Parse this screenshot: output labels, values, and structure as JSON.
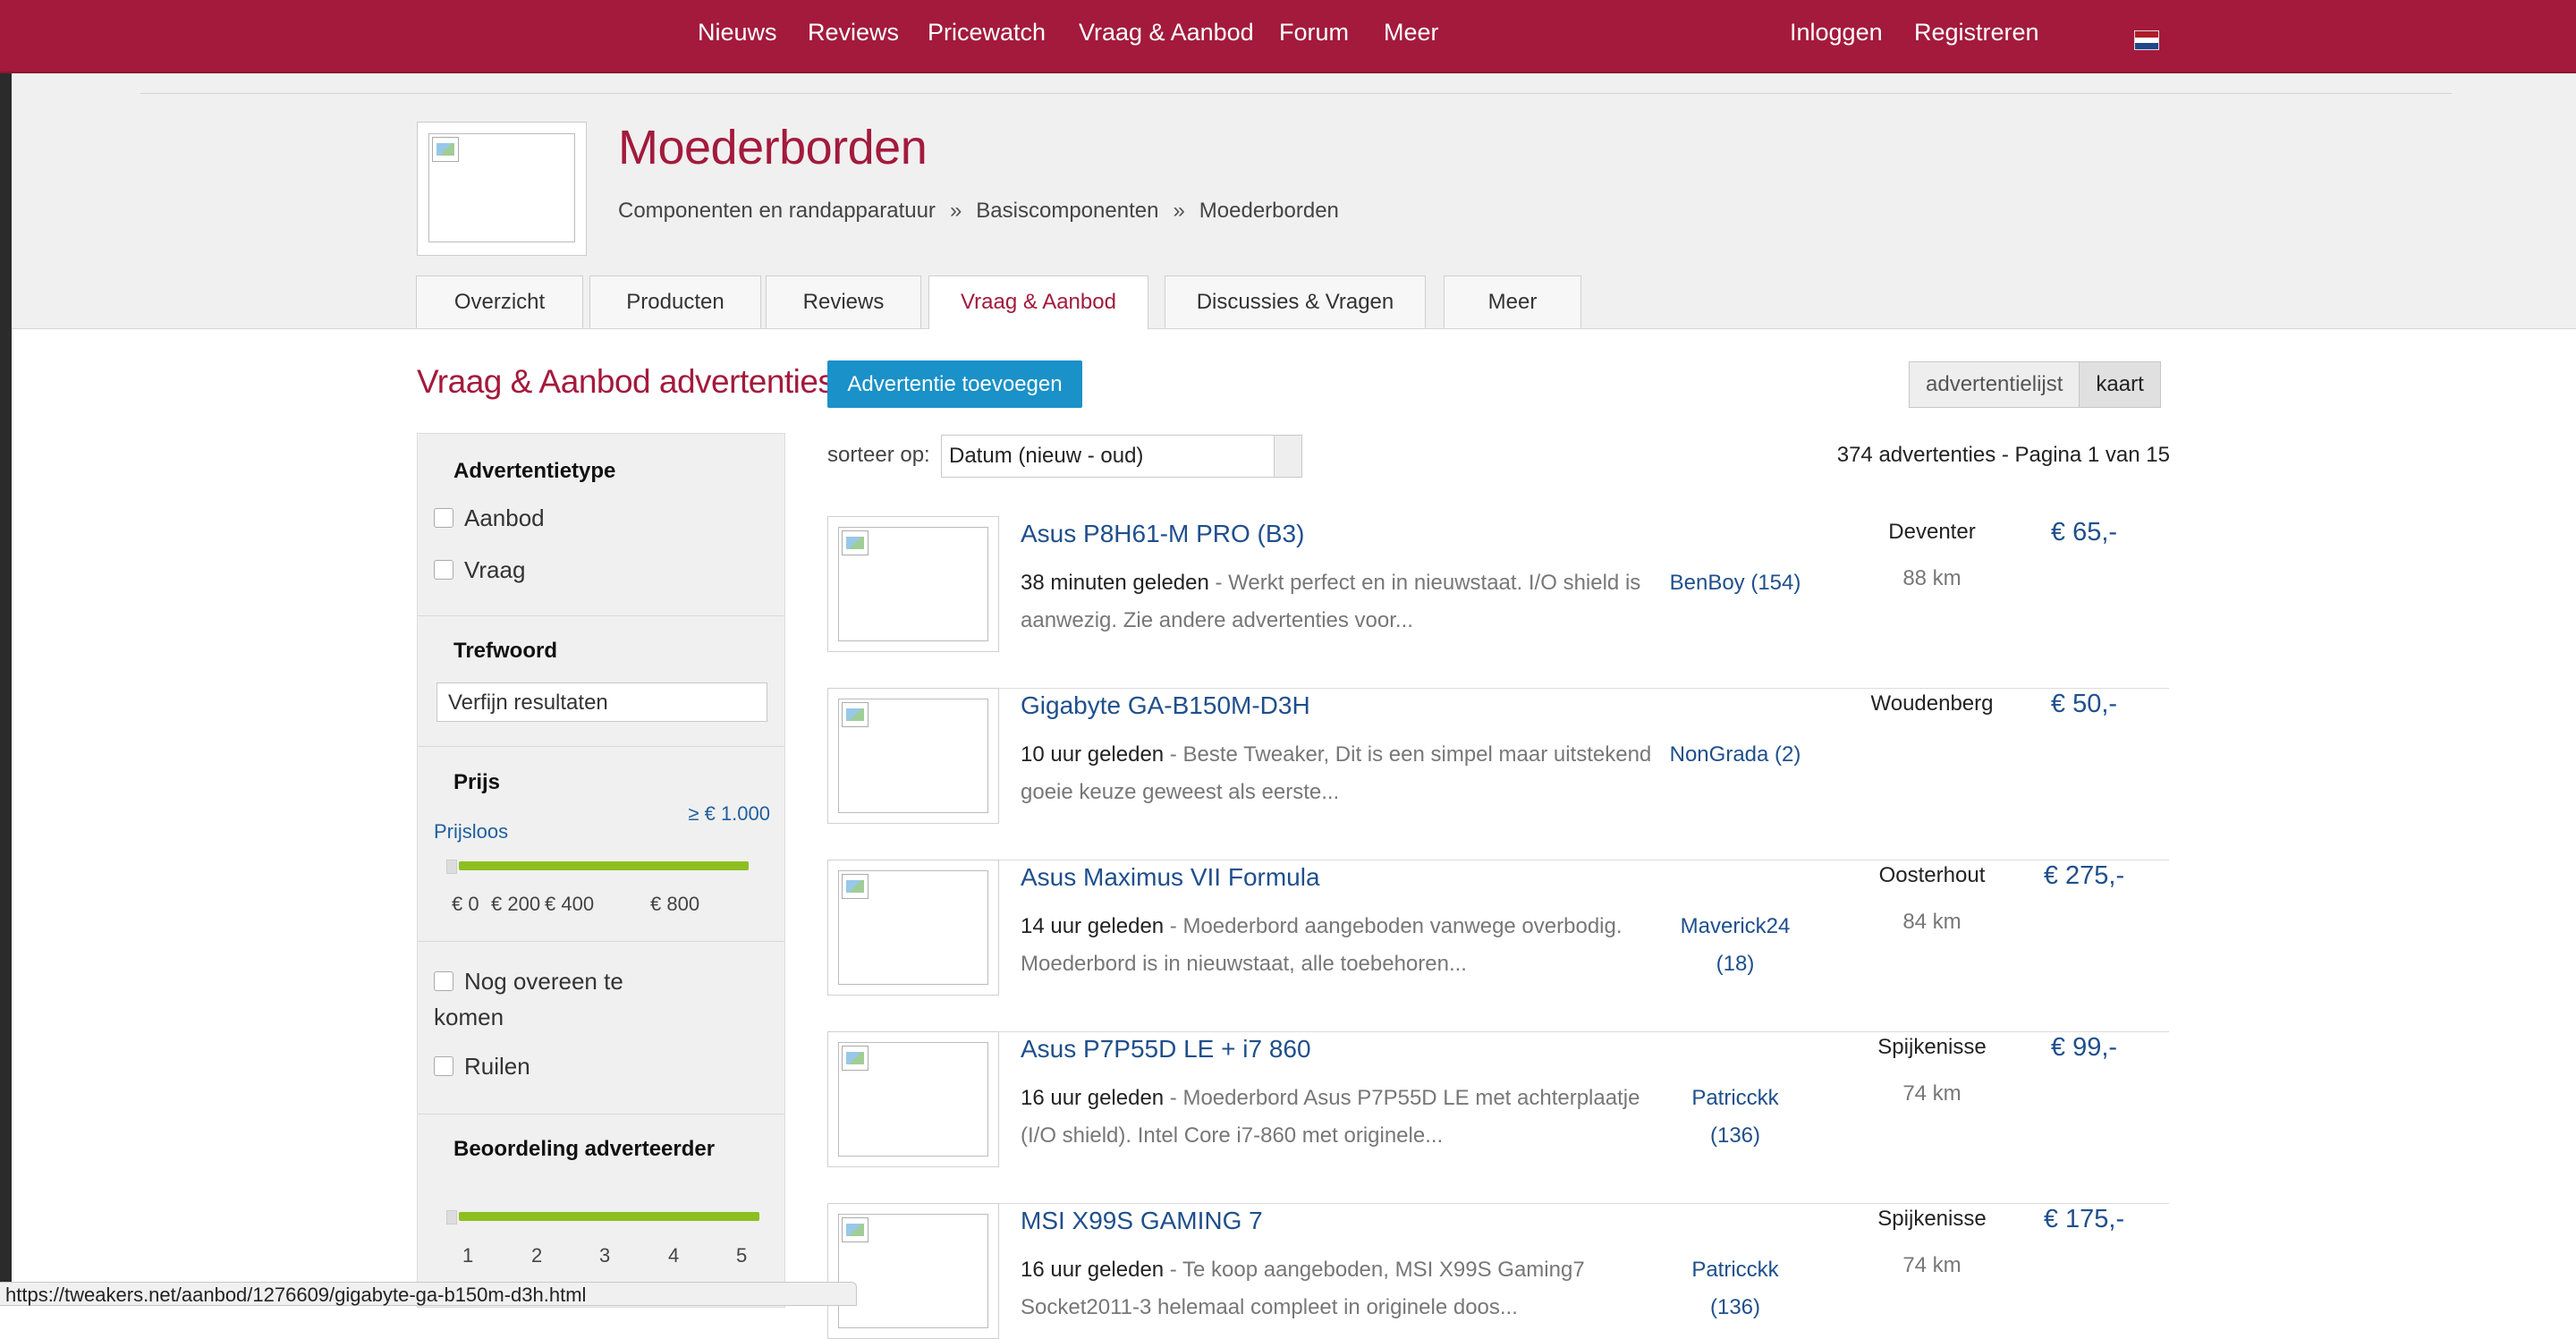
{
  "topnav": {
    "items": [
      "Nieuws",
      "Reviews",
      "Pricewatch",
      "Vraag & Aanbod",
      "Forum",
      "Meer"
    ],
    "login": "Inloggen",
    "register": "Registreren"
  },
  "header": {
    "title": "Moederborden",
    "breadcrumb": [
      "Componenten en randapparatuur",
      "Basiscomponenten",
      "Moederborden"
    ],
    "breadcrumb_sep": "»",
    "tabs": [
      "Overzicht",
      "Producten",
      "Reviews",
      "Vraag & Aanbod",
      "Discussies & Vragen",
      "Meer"
    ],
    "active_tab": "Vraag & Aanbod"
  },
  "section": {
    "title": "Vraag & Aanbod advertenties",
    "add_button": "Advertentie toevoegen",
    "view_list": "advertentielijst",
    "view_map": "kaart"
  },
  "sidebar": {
    "type_heading": "Advertentietype",
    "type_options": [
      "Aanbod",
      "Vraag"
    ],
    "keyword_heading": "Trefwoord",
    "keyword_placeholder": "Verfijn resultaten",
    "price_heading": "Prijs",
    "price_free": "Prijsloos",
    "price_max": "≥ € 1.000",
    "price_ticks": [
      "€ 0",
      "€ 200",
      "€ 400",
      "€ 800"
    ],
    "extra_options": [
      "Nog overeen te komen",
      "Ruilen"
    ],
    "rating_heading": "Beoordeling adverteerder",
    "rating_ticks": [
      "1",
      "2",
      "3",
      "4",
      "5"
    ]
  },
  "results": {
    "sort_label": "sorteer op:",
    "sort_value": "Datum (nieuw - oud)",
    "count": "374 advertenties - Pagina 1 van 15",
    "listings": [
      {
        "title": "Asus P8H61-M PRO (B3)",
        "time": "38 minuten geleden",
        "desc": " - Werkt perfect en in nieuwstaat. I/O shield is aanwezig. Zie andere advertenties voor...",
        "seller": "BenBoy (154)",
        "place": "Deventer",
        "distance": "88 km",
        "price": "€ 65,-"
      },
      {
        "title": "Gigabyte GA-B150M-D3H",
        "time": "10 uur geleden",
        "desc": " - Beste Tweaker, Dit is een simpel maar uitstekend goeie keuze geweest als eerste...",
        "seller": "NonGrada (2)",
        "place": "Woudenberg",
        "distance": "",
        "price": "€ 50,-"
      },
      {
        "title": "Asus Maximus VII Formula",
        "time": "14 uur geleden",
        "desc": " - Moederbord aangeboden vanwege overbodig. Moederbord is in nieuwstaat, alle toebehoren...",
        "seller": "Maverick24 (18)",
        "place": "Oosterhout",
        "distance": "84 km",
        "price": "€ 275,-"
      },
      {
        "title": "Asus P7P55D LE + i7 860",
        "time": "16 uur geleden",
        "desc": " - Moederbord Asus P7P55D LE met achterplaatje (I/O shield). Intel Core i7-860 met originele...",
        "seller": "Patricckk (136)",
        "place": "Spijkenisse",
        "distance": "74 km",
        "price": "€ 99,-"
      },
      {
        "title": "MSI X99S GAMING 7",
        "time": "16 uur geleden",
        "desc": " - Te koop aangeboden, MSI X99S Gaming7 Socket2011-3 helemaal compleet in originele doos...",
        "seller": "Patricckk (136)",
        "place": "Spijkenisse",
        "distance": "74 km",
        "price": "€ 175,-"
      }
    ]
  },
  "statusbar": "https://tweakers.net/aanbod/1276609/gigabyte-ga-b150m-d3h.html",
  "colors": {
    "brand": "#a31a3c",
    "link": "#1f4f8c",
    "button": "#1a91c8",
    "slider": "#8cbf1f"
  }
}
